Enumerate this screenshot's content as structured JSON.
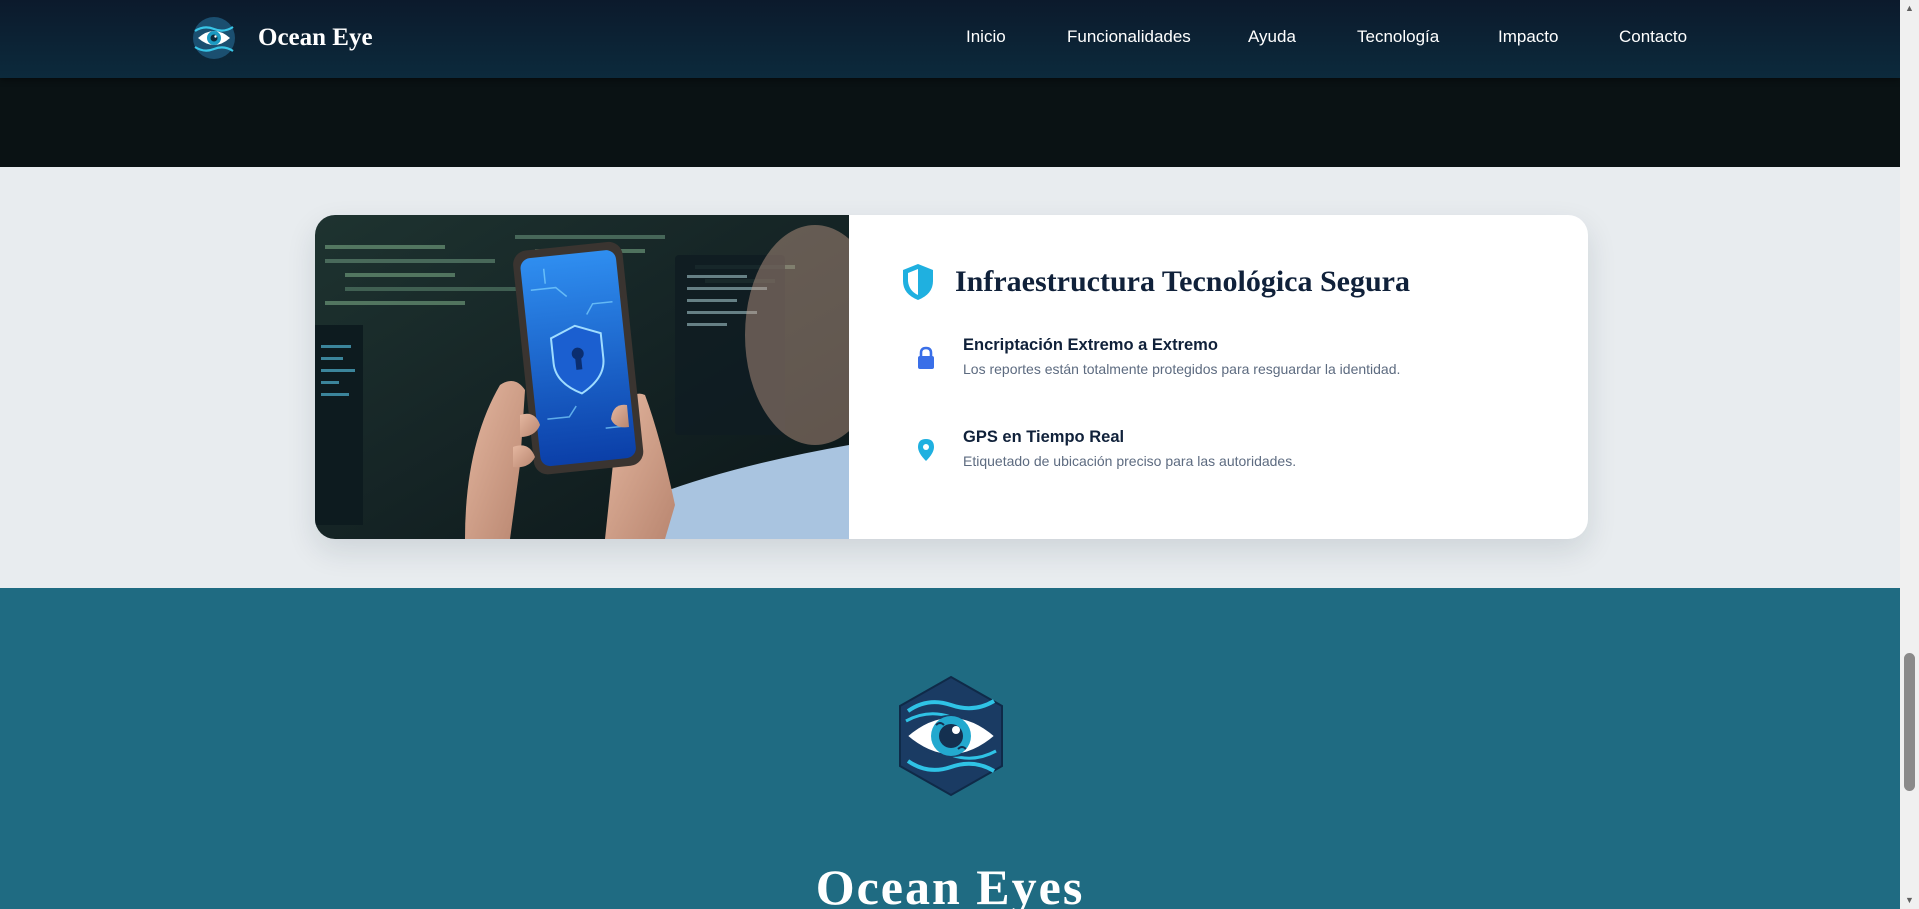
{
  "nav": {
    "brand": "Ocean Eye",
    "links": [
      "Inicio",
      "Funcionalidades",
      "Ayuda",
      "Tecnología",
      "Impacto",
      "Contacto"
    ]
  },
  "tech_card": {
    "title": "Infraestructura Tecnológica Segura",
    "features": [
      {
        "icon": "lock-icon",
        "title": "Encriptación Extremo a Extremo",
        "description": "Los reportes están totalmente protegidos para resguardar la identidad."
      },
      {
        "icon": "map-pin-icon",
        "title": "GPS en Tiempo Real",
        "description": "Etiquetado de ubicación preciso para las autoridades."
      }
    ]
  },
  "footer": {
    "title": "Ocean Eyes"
  },
  "colors": {
    "nav_background": "#0c1f30",
    "accent_cyan": "#1fb0e0",
    "lock_blue": "#3a6fe8",
    "teal_section": "#1f6b82",
    "light_section": "#e8ecef",
    "heading_text": "#10213a",
    "muted_text": "#5d6b80"
  }
}
